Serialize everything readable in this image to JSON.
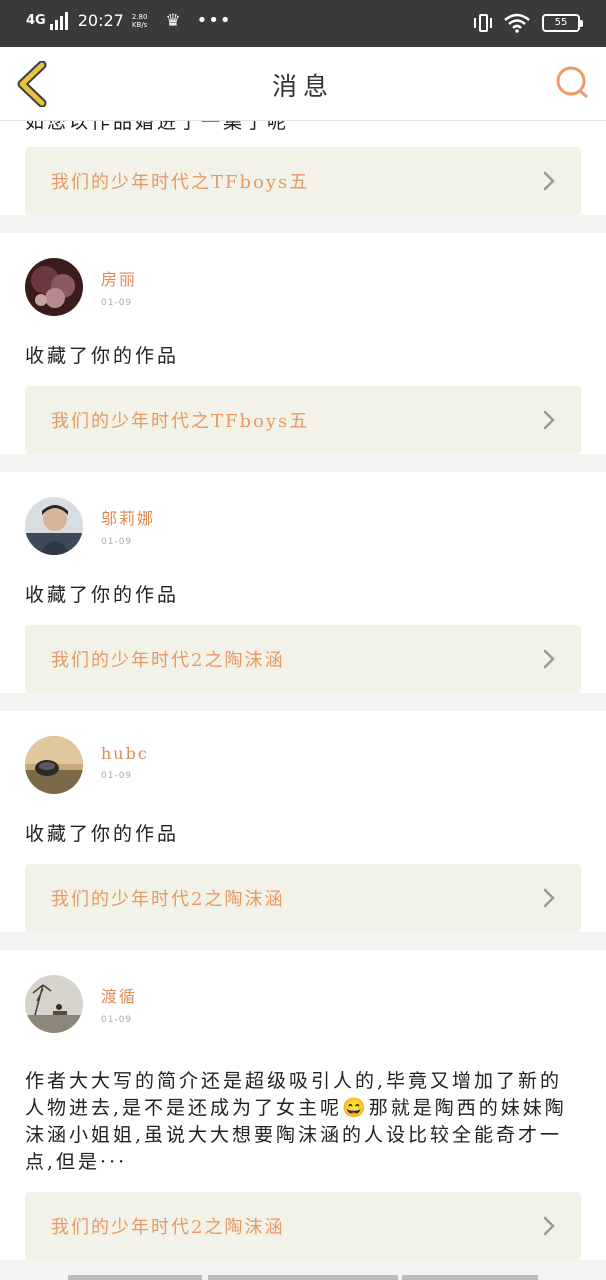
{
  "status_bar": {
    "network": "4G",
    "time": "20:27",
    "speed_value": "2.80",
    "speed_unit": "KB/s",
    "dots": "•••",
    "battery": "55"
  },
  "header": {
    "title": "消息"
  },
  "partial_card": {
    "text": "如您以作品婚进了一集了呢",
    "work_title": "我们的少年时代之TFboys五"
  },
  "messages": [
    {
      "username": "房丽",
      "date": "01-09",
      "text": "收藏了你的作品",
      "work_title": "我们的少年时代之TFboys五"
    },
    {
      "username": "邬莉娜",
      "date": "01-09",
      "text": "收藏了你的作品",
      "work_title": "我们的少年时代2之陶沫涵"
    },
    {
      "username": "hubc",
      "date": "01-09",
      "text": "收藏了你的作品",
      "work_title": "我们的少年时代2之陶沫涵"
    },
    {
      "username": "渡循",
      "date": "01-09",
      "text": "作者大大写的简介还是超级吸引人的,毕竟又增加了新的人物进去,是不是还成为了女主呢😄那就是陶西的妹妹陶沫涵小姐姐,虽说大大想要陶沫涵的人设比较全能奇才一点,但是···",
      "work_title": "我们的少年时代2之陶沫涵"
    }
  ],
  "colors": {
    "accent": "#e59a66",
    "username": "#e08a52",
    "back_icon": "#e6c341",
    "link_bg": "#f3f2e8",
    "statusbar_bg": "#3a3a3a"
  }
}
